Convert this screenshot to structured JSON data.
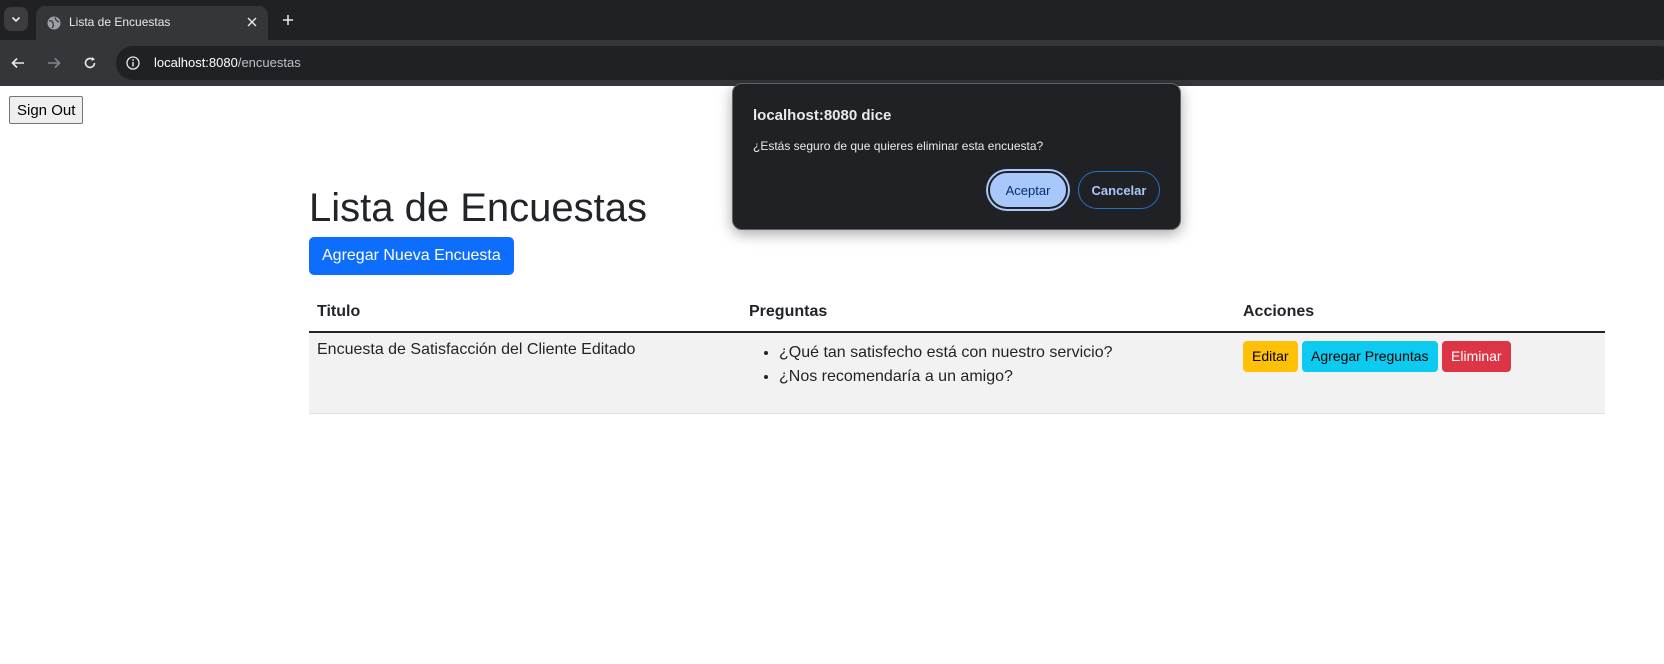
{
  "browser": {
    "tab_title": "Lista de Encuestas",
    "url_host": "localhost:8080",
    "url_path": "/encuestas"
  },
  "page": {
    "signout_label": "Sign Out",
    "title": "Lista de Encuestas",
    "add_button_label": "Agregar Nueva Encuesta",
    "table": {
      "headers": [
        "Titulo",
        "Preguntas",
        "Acciones"
      ],
      "rows": [
        {
          "titulo": "Encuesta de Satisfacción del Cliente Editado",
          "preguntas": [
            "¿Qué tan satisfecho está con nuestro servicio?",
            "¿Nos recomendaría a un amigo?"
          ],
          "acciones": [
            "Editar",
            "Agregar Preguntas",
            "Eliminar"
          ]
        }
      ]
    }
  },
  "dialog": {
    "title": "localhost:8080 dice",
    "message": "¿Estás seguro de que quieres eliminar esta encuesta?",
    "ok_label": "Aceptar",
    "cancel_label": "Cancelar"
  },
  "colors": {
    "primary": "#0d6efd",
    "warning": "#ffc107",
    "info": "#0dcaf0",
    "danger": "#dc3545",
    "dialog_accent": "#a8c7fa"
  }
}
